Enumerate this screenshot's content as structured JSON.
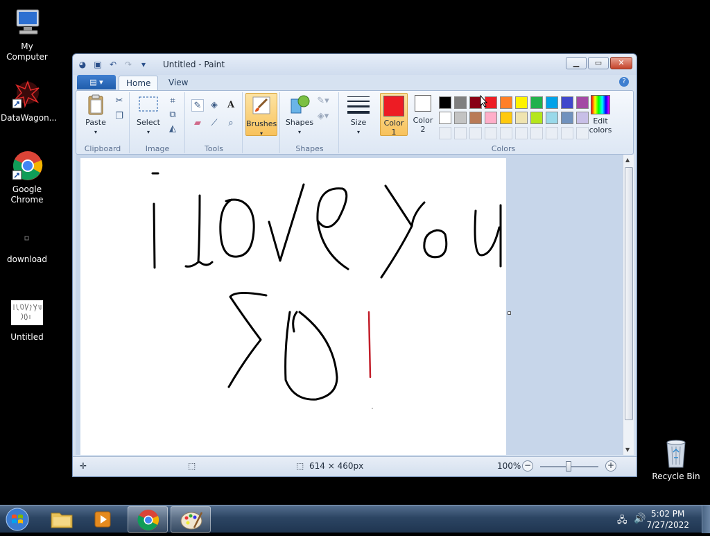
{
  "desktop": {
    "icons": [
      {
        "label": "My Computer"
      },
      {
        "label": "DataWagon..."
      },
      {
        "label": "Google Chrome"
      },
      {
        "label": "download"
      },
      {
        "label": "Untitled"
      },
      {
        "label": "Recycle Bin"
      }
    ]
  },
  "window": {
    "title": "Untitled - Paint",
    "tabs": [
      "Home",
      "View"
    ],
    "help": "?"
  },
  "ribbon": {
    "clipboard": {
      "name": "Clipboard",
      "paste": "Paste"
    },
    "image": {
      "name": "Image",
      "select": "Select"
    },
    "tools": {
      "name": "Tools",
      "text_tool": "A"
    },
    "brushes": {
      "label": "Brushes"
    },
    "shapes": {
      "name": "Shapes",
      "label": "Shapes"
    },
    "size": {
      "label": "Size"
    },
    "colors": {
      "name": "Colors",
      "color1": "Color 1",
      "color2": "Color 2",
      "color1_value": "#ed1c24",
      "color2_value": "#ffffff",
      "edit": "Edit colors",
      "row1": [
        "#000000",
        "#7f7f7f",
        "#880015",
        "#ed1c24",
        "#ff7f27",
        "#fff200",
        "#22b14c",
        "#00a2e8",
        "#3f48cc",
        "#a349a4"
      ],
      "row2": [
        "#ffffff",
        "#c3c3c3",
        "#b97a57",
        "#ffaec9",
        "#ffc90e",
        "#efe4b0",
        "#b5e61d",
        "#99d9ea",
        "#7092be",
        "#c8bfe7"
      ]
    }
  },
  "status": {
    "size": "614 × 460px",
    "zoom": "100%"
  },
  "taskbar": {
    "time": "5:02 PM",
    "date": "7/27/2022"
  }
}
